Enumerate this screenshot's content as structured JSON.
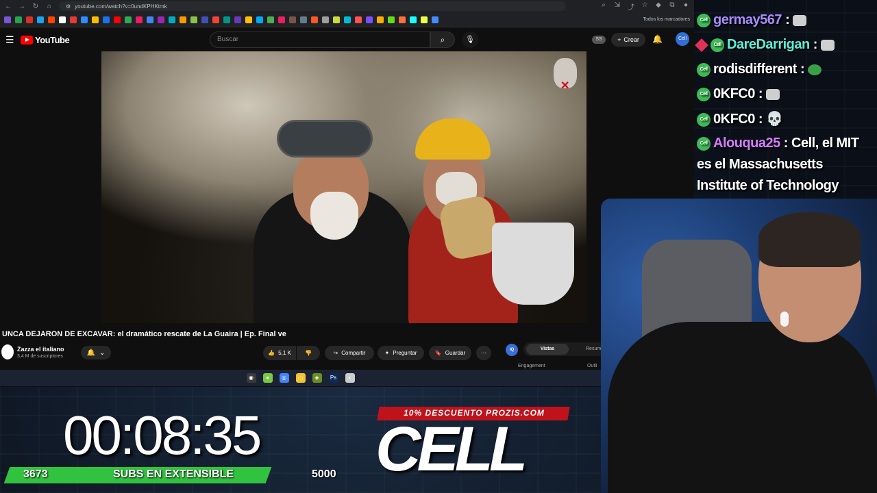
{
  "browser": {
    "url": "youtube.com/watch?v=0undKPHKtmk",
    "bookmarks_all": "Todos los marcadores",
    "bookmark_colors": [
      "#7a56d8",
      "#2aa34d",
      "#d93025",
      "#1da1f2",
      "#ff4500",
      "#ffffff",
      "#e53935",
      "#2d8cff",
      "#fbbc04",
      "#1a73e8",
      "#ff0000",
      "#34a853",
      "#e91e63",
      "#4285f4",
      "#9c27b0",
      "#00acc1",
      "#ff9800",
      "#8bc34a",
      "#3f51b5",
      "#f44336",
      "#009688",
      "#673ab7",
      "#ffc107",
      "#03a9f4",
      "#4caf50",
      "#e91e63",
      "#795548",
      "#607d8b",
      "#ff5722",
      "#9e9e9e",
      "#cddc39",
      "#00bcd4",
      "#ff5252",
      "#7c4dff",
      "#ffab00",
      "#64dd17",
      "#ff6e40",
      "#18ffff",
      "#eeff41",
      "#448aff"
    ]
  },
  "youtube": {
    "logo_text": "YouTube",
    "search_placeholder": "Buscar",
    "ss_badge": "SS",
    "create_label": "Crear",
    "avatar_text": "Cell",
    "video_title": "UNCA DEJARON DE EXCAVAR: el dramático rescate de La Guaira | Ep. Final ve",
    "channel_name": "Zazza el italiano",
    "channel_subs": "3,4 M de suscriptores",
    "likes": "5,1 K",
    "share_label": "Compartir",
    "ask_label": "Preguntar",
    "save_label": "Guardar"
  },
  "extension": {
    "badge": "IQ",
    "tab_active": "Vistas",
    "tab_other": "Resum",
    "engagement": "Engagement",
    "outline": "Outli"
  },
  "chat": [
    {
      "user": "germay567",
      "color": "#a98cff",
      "text": " : "
    },
    {
      "user": "DareDarrigan",
      "color": "#5cf0d8",
      "text": " : "
    },
    {
      "user": "rodisdifferent",
      "color": "#ffffff",
      "text": " : "
    },
    {
      "user": "0KFC0",
      "color": "#ffffff",
      "text": " : "
    },
    {
      "user": "0KFC0",
      "color": "#ffffff",
      "text": " : "
    },
    {
      "user": "Alouqua25",
      "color": "#d77cff",
      "text": " : Cell, el MIT"
    }
  ],
  "chat_wrap": [
    "es el Massachusetts",
    "Institute of Technology"
  ],
  "chat_badge": "Cell",
  "timer": "00:08:35",
  "subs": {
    "current": "3673",
    "label": "SUBS EN EXTENSIBLE",
    "goal": "5000",
    "progress": 0.7346
  },
  "promo": {
    "banner": "10% DESCUENTO PROZIS.COM",
    "logo": "CELL"
  }
}
